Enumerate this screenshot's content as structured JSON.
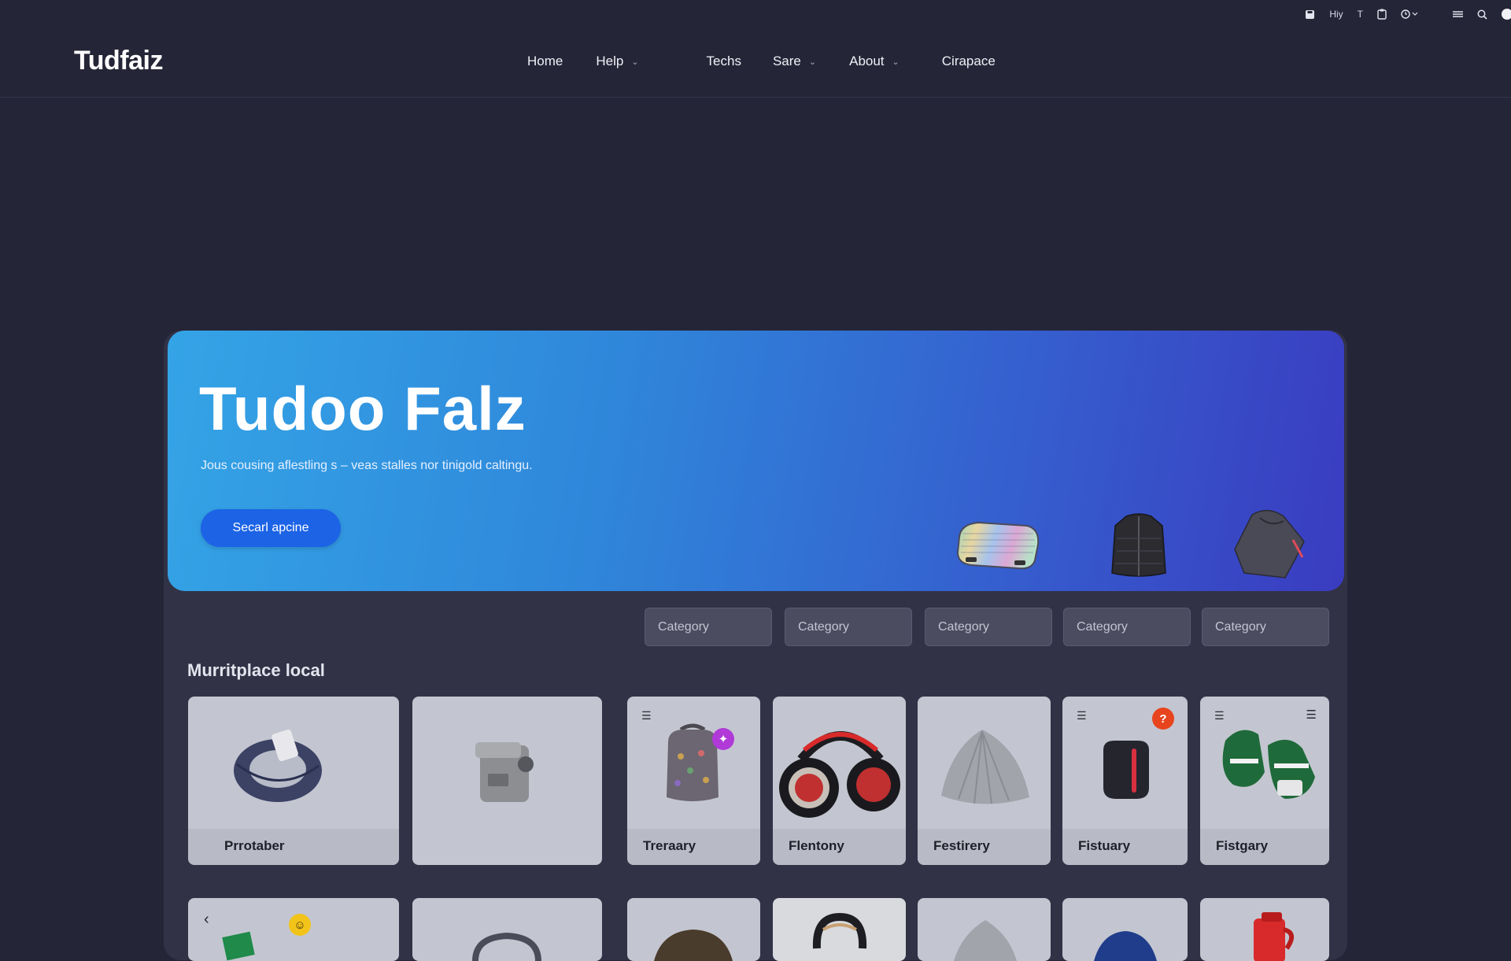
{
  "topbar": {
    "items": [
      "Hiy",
      "T"
    ]
  },
  "header": {
    "logo": "Tudfaiz",
    "nav": [
      {
        "label": "Home",
        "dropdown": false
      },
      {
        "label": "Help",
        "dropdown": true
      },
      {
        "label": "Techs",
        "dropdown": false
      },
      {
        "label": "Sare",
        "dropdown": true
      },
      {
        "label": "About",
        "dropdown": true
      },
      {
        "label": "Cirapace",
        "dropdown": false
      }
    ]
  },
  "hero": {
    "title": "Tudoo Falz",
    "subtitle": "Jous cousing aflestling s – veas stalles nor tinigold caltingu.",
    "cta": "Secarl apcine",
    "gradient": [
      "#34a4e6",
      "#3a3cc0"
    ]
  },
  "categories": [
    "Category",
    "Category",
    "Category",
    "Category",
    "Category"
  ],
  "marketplace": {
    "title": "Murritplace local",
    "cards": [
      {
        "label": "Prrotaber",
        "icon": "knit-band-icon"
      },
      {
        "label": "",
        "icon": "camera-icon"
      },
      {
        "label": "Treraary",
        "icon": "backpack-icon"
      },
      {
        "label": "Flentony",
        "icon": "headphones-icon"
      },
      {
        "label": "Festirery",
        "icon": "beanie-icon"
      },
      {
        "label": "Fistuary",
        "icon": "pouch-icon"
      },
      {
        "label": "Fistgary",
        "icon": "mittens-icon"
      }
    ]
  },
  "colors": {
    "background": "#252538",
    "accent": "#1c63e6",
    "card": "#c3c6d0"
  }
}
